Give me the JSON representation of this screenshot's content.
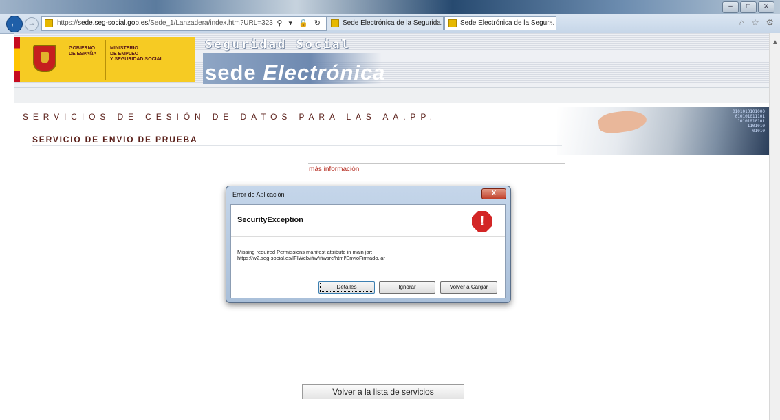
{
  "browser": {
    "window_buttons": [
      "–",
      "□",
      "⨯"
    ],
    "url_prefix": "https://",
    "url_domain": "sede.seg-social.gob.es",
    "url_path": "/Sede_1/Lanzadera/index.htm?URL=323",
    "addr_tools": "⚲ ▾ 🔒 ↻",
    "tabs": [
      {
        "title": "Sede Electrónica de la Segurida..."
      },
      {
        "title": "Sede Electrónica de la Segur...",
        "close": "×"
      }
    ],
    "right_icons": "⌂ ☆ ⚙"
  },
  "banner": {
    "gobierno": [
      "GOBIERNO",
      "DE ESPAÑA"
    ],
    "ministerio": [
      "MINISTERIO",
      "DE EMPLEO",
      "Y SEGURIDAD SOCIAL"
    ],
    "seg_social": "Seguridad Social",
    "sede": "sede",
    "electronica": "Electrónica"
  },
  "page": {
    "services_header": "SERVICIOS DE CESIÓN DE DATOS PARA LAS AA.PP.",
    "service_title": "SERVICIO DE ENVIO DE PRUEBA",
    "more_info": "más información",
    "back_to_list": "Volver a la lista de servicios",
    "binary": [
      "0101010101000",
      "010101011101",
      "10101010101",
      "1101010",
      "01010"
    ]
  },
  "dialog": {
    "title": "Error de Aplicación",
    "close": "X",
    "exception": "SecurityException",
    "icon_glyph": "!",
    "message_line1": "Missing required Permissions manifest attribute in main jar:",
    "message_line2": "https://w2.seg-social.es/IFIWeb/ifiw/ifiwsrc/html/EnvioFirmado.jar",
    "buttons": {
      "details": "Detalles",
      "ignore": "Ignorar",
      "reload": "Volver a Cargar"
    }
  },
  "colors": {
    "accent_maroon": "#5a1f19",
    "link_red": "#b3261a",
    "gov_yellow": "#f6cb23"
  }
}
